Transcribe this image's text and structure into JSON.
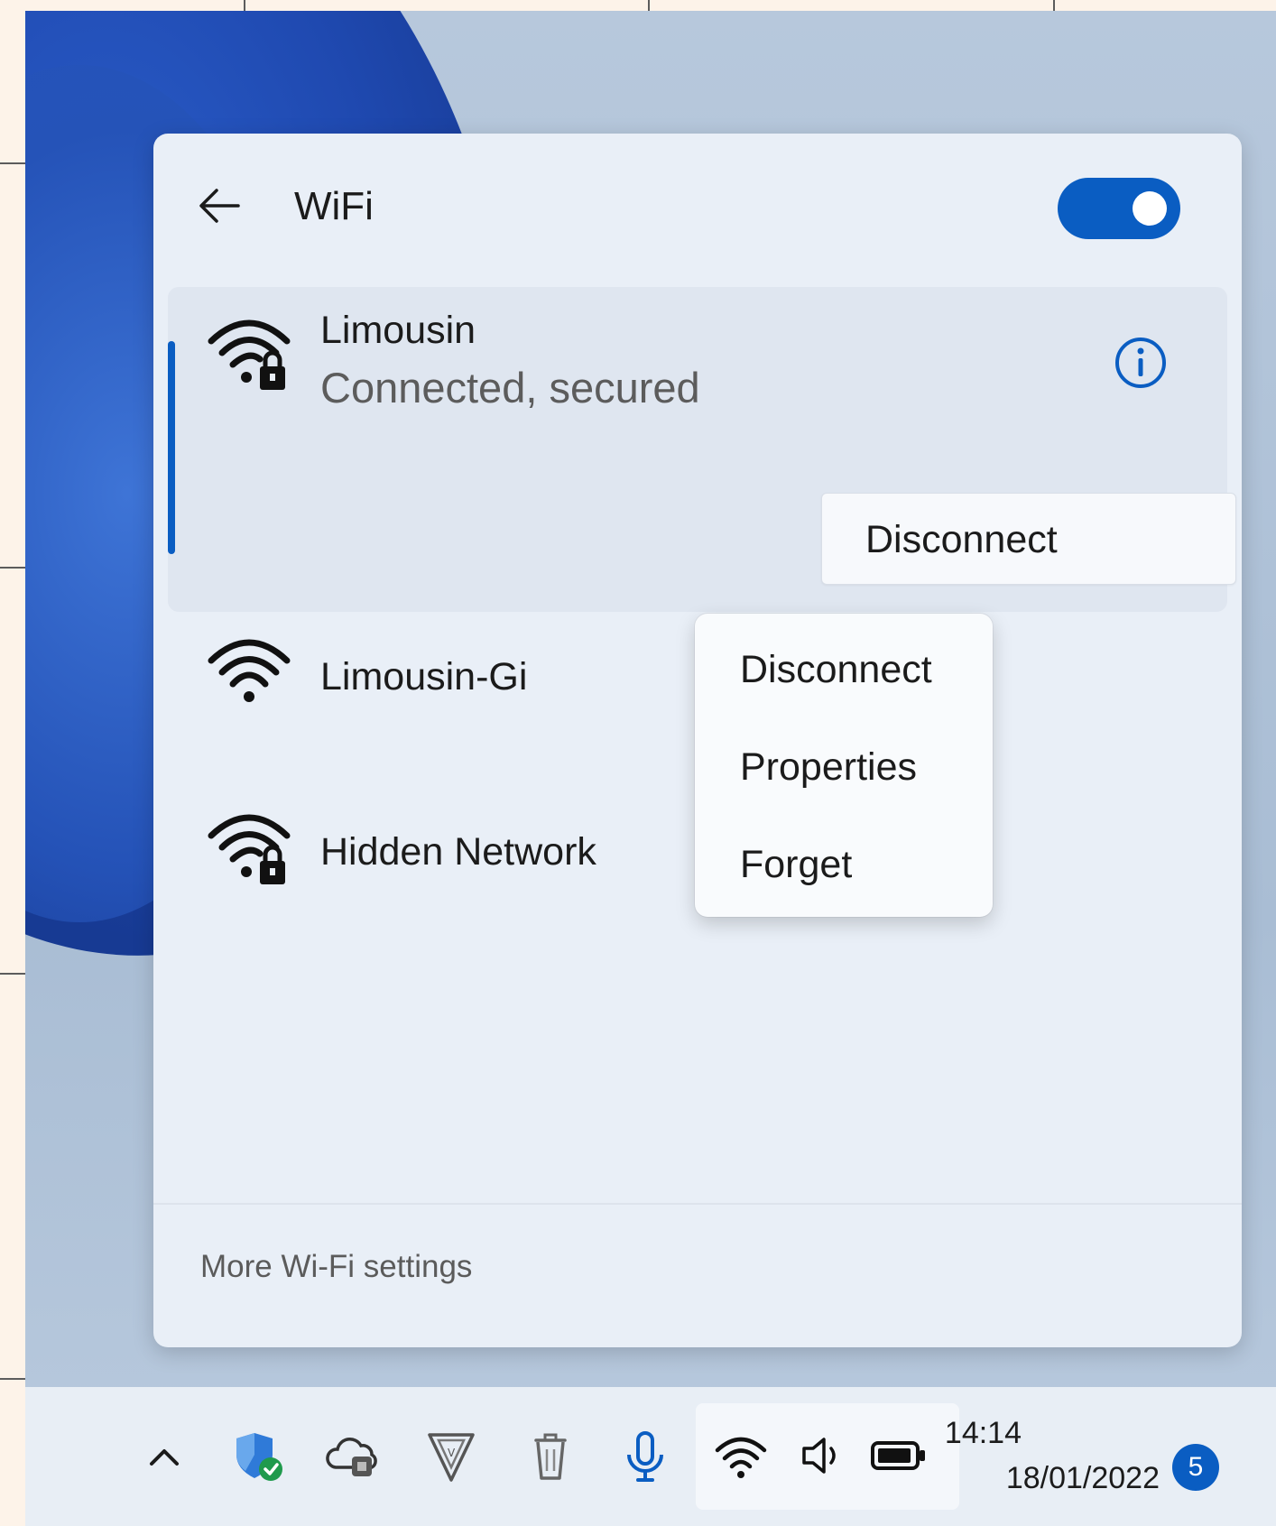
{
  "panel": {
    "title": "WiFi",
    "toggle_state": "on",
    "accent_color": "#0a5dc2"
  },
  "networks": [
    {
      "name": "Limousin",
      "status": "Connected, secured",
      "icon": "wifi-secured-icon"
    },
    {
      "name": "Limousin-Gi",
      "icon": "wifi-icon"
    },
    {
      "name": "Hidden Network",
      "icon": "wifi-secured-icon"
    }
  ],
  "disconnect_button": {
    "label": "Disconnect"
  },
  "context_menu": {
    "items": [
      "Disconnect",
      "Properties",
      "Forget"
    ]
  },
  "footer": {
    "more_settings": "More Wi-Fi settings"
  },
  "taskbar": {
    "icons": [
      "chevron-up-icon",
      "security-shield-icon",
      "onedrive-cloud-icon",
      "vpn-icon",
      "recycle-bin-icon",
      "microphone-icon"
    ],
    "tray_icons": [
      "wifi-icon",
      "volume-icon",
      "battery-icon"
    ],
    "time": "14:14",
    "date": "18/01/2022",
    "notification_count": "5"
  }
}
